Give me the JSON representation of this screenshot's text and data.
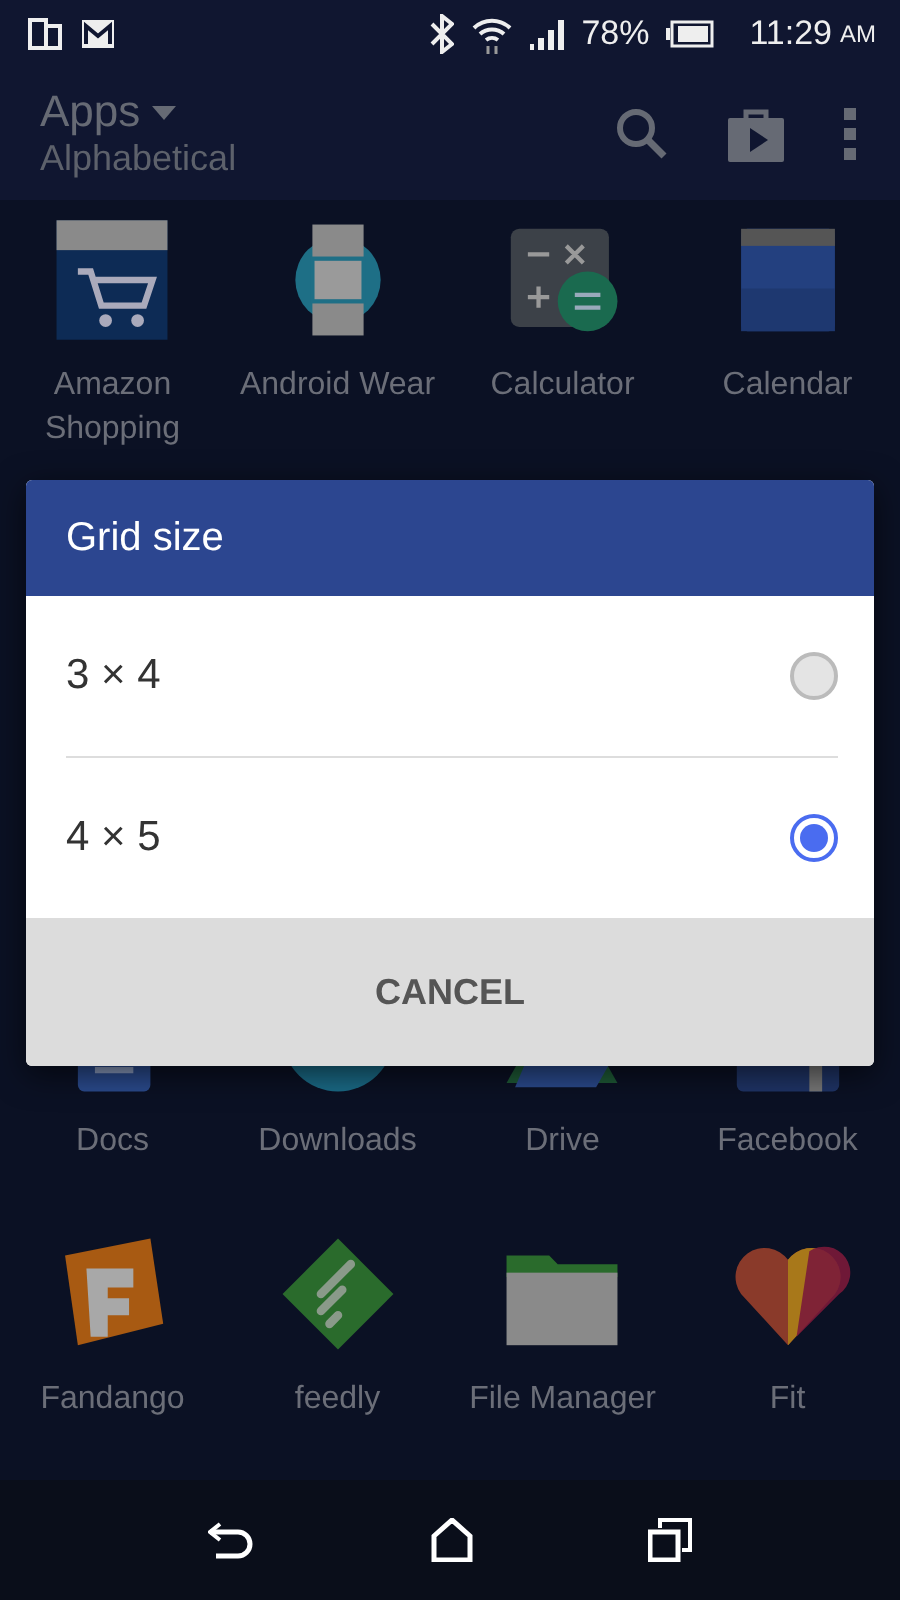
{
  "status_bar": {
    "battery": "78%",
    "time": "11:29",
    "meridiem": "AM"
  },
  "app_bar": {
    "title": "Apps",
    "subtitle": "Alphabetical"
  },
  "app_rows": [
    {
      "apps": [
        {
          "label": "Amazon Shopping"
        },
        {
          "label": "Android Wear"
        },
        {
          "label": "Calculator"
        },
        {
          "label": "Calendar"
        }
      ]
    },
    {
      "apps": [
        {
          "label": "Docs"
        },
        {
          "label": "Downloads"
        },
        {
          "label": "Drive"
        },
        {
          "label": "Facebook"
        }
      ]
    },
    {
      "apps": [
        {
          "label": "Fandango"
        },
        {
          "label": "feedly"
        },
        {
          "label": "File Manager"
        },
        {
          "label": "Fit"
        }
      ]
    }
  ],
  "dialog": {
    "title": "Grid size",
    "options": [
      {
        "label": "3 × 4",
        "selected": false
      },
      {
        "label": "4 × 5",
        "selected": true
      }
    ],
    "button": "CANCEL"
  }
}
